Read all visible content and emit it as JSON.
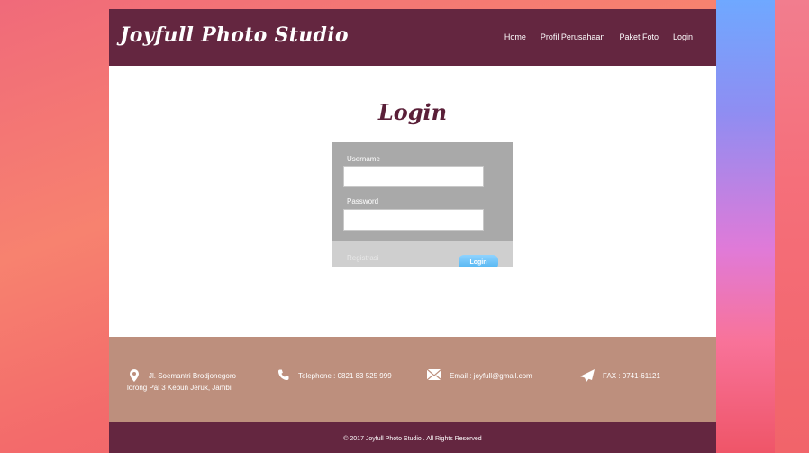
{
  "header": {
    "logo": "Joyfull Photo Studio",
    "nav": [
      "Home",
      "Profil Perusahaan",
      "Paket Foto",
      "Login"
    ]
  },
  "login": {
    "title": "Login",
    "username_label": "Username",
    "username_value": "",
    "password_label": "Password",
    "password_value": "",
    "register_link": "Registrasi",
    "login_button": "Login"
  },
  "footer": {
    "address_line1": "Jl. Soemantri Brodjonegoro",
    "address_line2": "lorong Pal 3 Kebun Jeruk, Jambi",
    "telephone": "Telephone : 0821 83 525 999",
    "email": "Email : joyfull@gmail.com",
    "fax": "FAX : 0741-61121",
    "icons": [
      "map-pin-icon",
      "phone-icon",
      "mail-icon",
      "paper-plane-icon"
    ]
  },
  "copyright": "© 2017 Joyfull Photo Studio . All Rights Reserved",
  "colors": {
    "header": "#642640",
    "footer": "#bd8f7d",
    "title": "#5a1f38",
    "button": "#4fb3f0"
  }
}
